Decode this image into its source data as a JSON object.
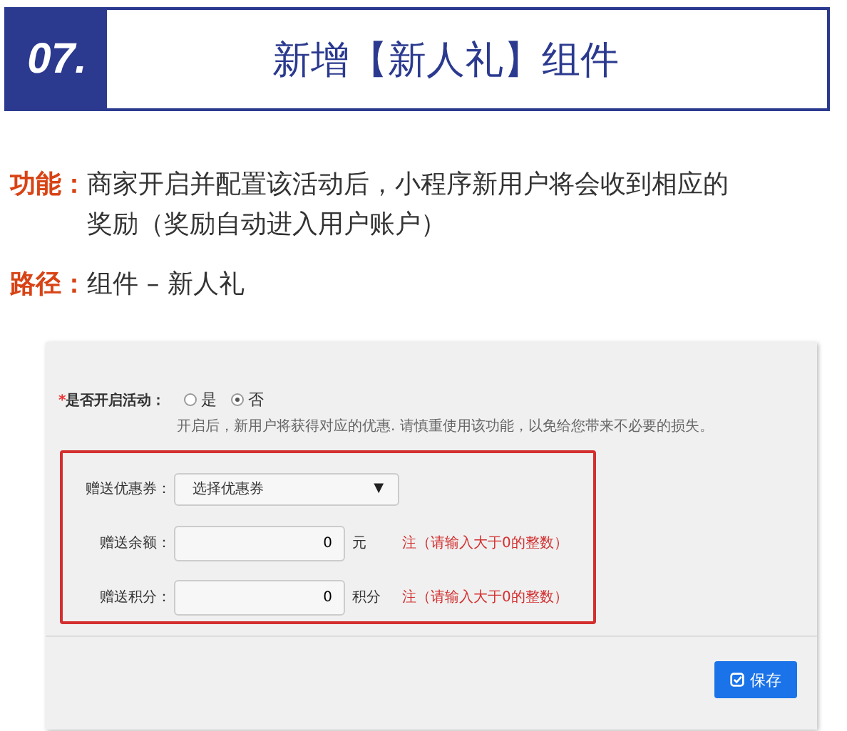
{
  "header": {
    "number": "07.",
    "title": "新增【新人礼】组件"
  },
  "descriptions": [
    {
      "label": "功能：",
      "text": "商家开启并配置该活动后，小程序新用户将会收到相应的奖励（奖励自动进入用户账户）"
    },
    {
      "label": "路径：",
      "text": "组件 – 新人礼"
    }
  ],
  "form": {
    "enable": {
      "required_mark": "*",
      "label": "是否开启活动：",
      "options": [
        {
          "label": "是",
          "selected": false
        },
        {
          "label": "否",
          "selected": true
        }
      ],
      "hint": "开启后，新用户将获得对应的优惠. 请慎重使用该功能，以免给您带来不必要的损失。"
    },
    "fields": [
      {
        "kind": "select",
        "label": "赠送优惠券：",
        "value": "选择优惠券",
        "caret": "▼"
      },
      {
        "kind": "input",
        "label": "赠送余额：",
        "value": "0",
        "unit": "元",
        "note": "注（请输入大于0的整数）"
      },
      {
        "kind": "input",
        "label": "赠送积分：",
        "value": "0",
        "unit": "积分",
        "note": "注（请输入大于0的整数）"
      }
    ],
    "save_button": "保存"
  }
}
